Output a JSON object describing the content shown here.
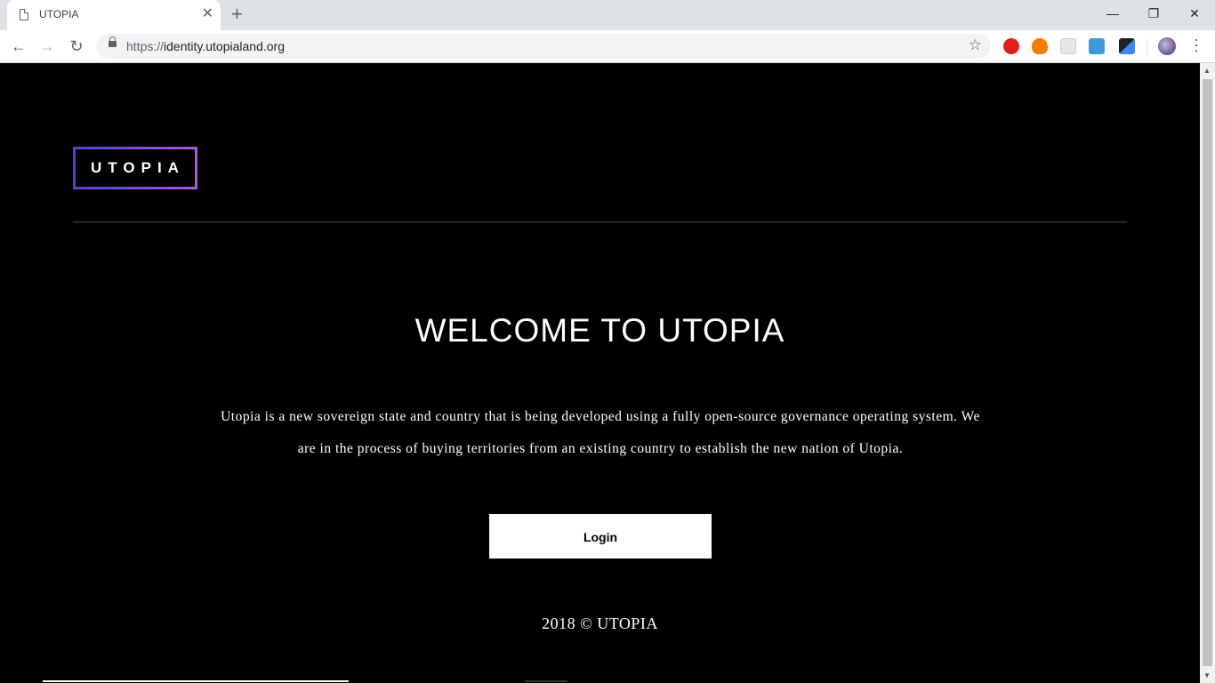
{
  "browser": {
    "tab_title": "UTOPIA",
    "tab_close": "✕",
    "new_tab": "+",
    "window_controls": {
      "minimize": "—",
      "restore": "❐",
      "close": "✕"
    },
    "nav": {
      "back": "←",
      "forward": "→",
      "reload": "↻"
    },
    "url_scheme": "https://",
    "url_host": "identity.utopialand.org",
    "bookmark_star": "☆",
    "menu": "⋮",
    "extensions": [
      {
        "name": "opera-vpn-extension-icon",
        "color": "#e0201b"
      },
      {
        "name": "fire-extension-icon",
        "color": "#f57c00"
      },
      {
        "name": "grid-extension-icon",
        "color": "#d6d6d6"
      },
      {
        "name": "g-extension-icon",
        "color": "#3c9bd6"
      },
      {
        "name": "pen-extension-icon",
        "color": "#4285f4"
      }
    ]
  },
  "page": {
    "logo_text": "UTOPIA",
    "welcome_title": "WELCOME TO UTOPIA",
    "description": "Utopia is a new sovereign state and country that is being developed using a fully open-source governance operating system. We are in the process of buying territories from an existing country to establish the new nation of Utopia.",
    "login_label": "Login",
    "footer_text": "2018 © UTOPIA"
  },
  "colors": {
    "background": "#000000",
    "text": "#ffffff",
    "logo_border_start": "#5b3fc7",
    "logo_border_end": "#a65bd8",
    "button_bg": "#ffffff"
  }
}
